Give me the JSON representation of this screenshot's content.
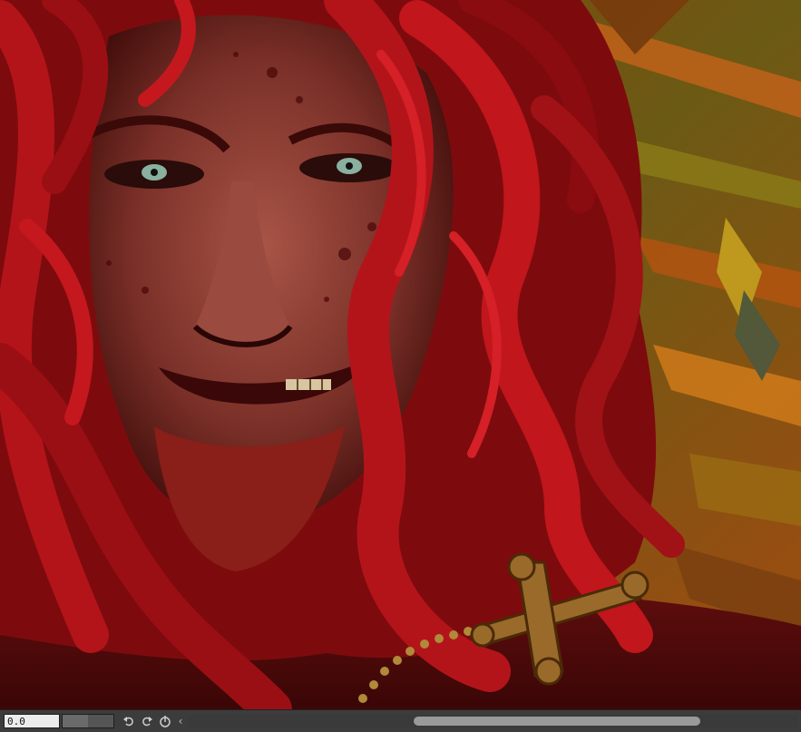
{
  "canvas": {
    "artwork": "digital-painting-red-haired-man-with-cross",
    "palette": {
      "hair": "#a80f12",
      "skin": "#8a3d33",
      "shadow": "#3a0606",
      "background_orange": "#b35a12",
      "background_olive": "#6b5a14",
      "cross_gold": "#9a6a2a"
    }
  },
  "statusbar": {
    "zoom_value": "0.0",
    "zoom_fill": 0.5,
    "undo_icon": "undo-icon",
    "redo_icon": "redo-icon",
    "rotate_icon": "rotate-reset-icon",
    "scroll_left_icon": "chevron-left-icon",
    "scroll_left_glyph": "‹",
    "scroll_thumb_start": 0.37,
    "scroll_thumb_size": 0.47
  }
}
